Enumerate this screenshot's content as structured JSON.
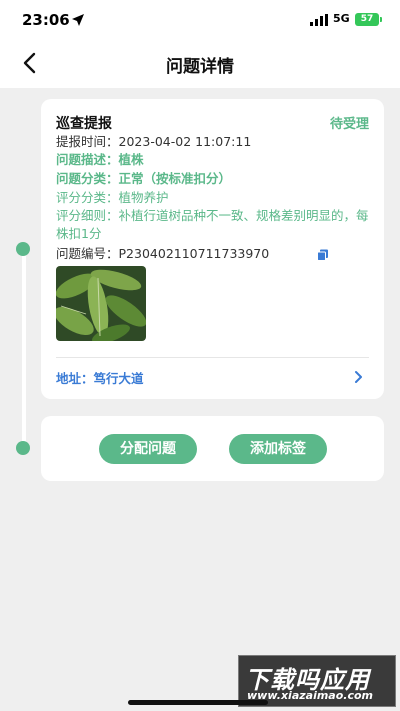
{
  "status_bar": {
    "time": "23:06",
    "network": "5G",
    "battery": "57"
  },
  "header": {
    "title": "问题详情"
  },
  "report": {
    "title": "巡查提报",
    "status": "待受理",
    "time_label": "提报时间：",
    "time_value": "2023-04-02 11:07:11",
    "desc_label": "问题描述：",
    "desc_value": "植株",
    "category_label": "问题分类：",
    "category_value": "正常（按标准扣分）",
    "score_cat_label": "评分分类：",
    "score_cat_value": "植物养护",
    "score_detail_label": "评分细则：",
    "score_detail_value": "补植行道树品种不一致、规格差别明显的，每株扣1分",
    "code_label": "问题编号：",
    "code_value": "P230402110711733970",
    "address_label": "地址：",
    "address_value": "笃行大道"
  },
  "actions": {
    "assign": "分配问题",
    "add_tag": "添加标签"
  },
  "watermark": {
    "main": "下载吗应用",
    "url": "www.xiazaimao.com"
  },
  "colors": {
    "accent": "#5bb88a",
    "link": "#3a7bd5",
    "background": "#efefef"
  }
}
